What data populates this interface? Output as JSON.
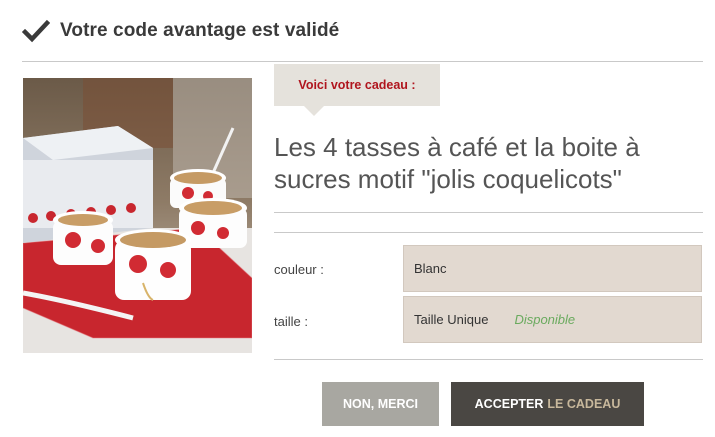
{
  "header": {
    "title": "Votre code avantage est validé",
    "icon": "check-icon"
  },
  "gift": {
    "tag_label": "Voici votre cadeau :",
    "title": "Les 4 tasses à café et la boite à sucres motif \"jolis coquelicots\""
  },
  "fields": [
    {
      "label": "couleur :",
      "value": "Blanc",
      "availability": ""
    },
    {
      "label": "taille :",
      "value": "Taille Unique",
      "availability": "Disponible"
    }
  ],
  "buttons": {
    "refuse": "NON, MERCI",
    "accept_main": "ACCEPTER",
    "accept_accent": "LE CADEAU"
  },
  "colors": {
    "tag_text": "#b0151e",
    "availability": "#6aaa5e",
    "accept_button": "#4a4743",
    "refuse_button": "#a8a7a1",
    "field_bg": "#e2d9d0"
  }
}
